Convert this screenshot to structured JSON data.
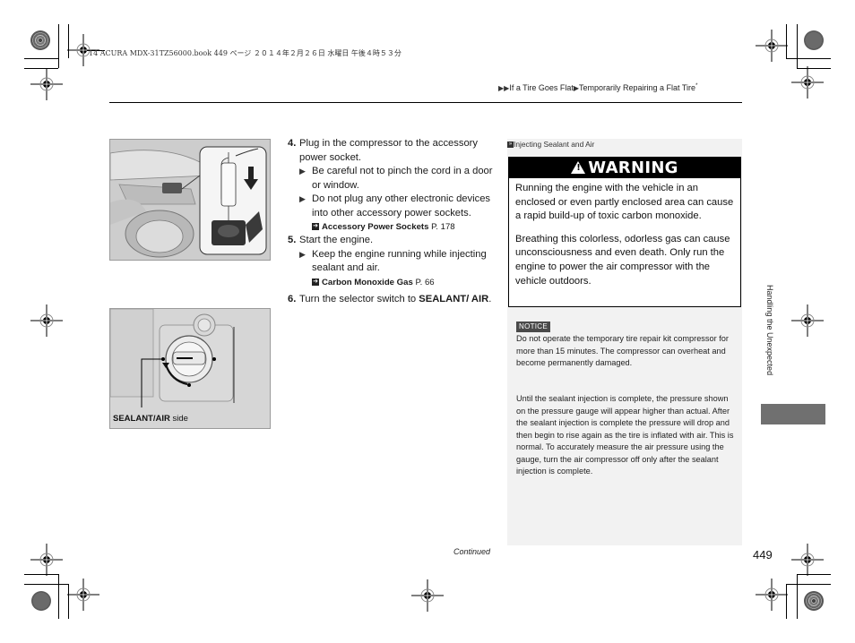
{
  "print_header": "14 ACURA MDX-31TZ56000.book  449 ページ  ２０１４年２月２６日  水曜日  午後４時５３分",
  "breadcrumb": {
    "items": [
      "If a Tire Goes Flat",
      "Temporarily Repairing a Flat Tire"
    ],
    "suffix": "*"
  },
  "figures": [
    {
      "name": "accessory-socket-illustration"
    },
    {
      "name": "selector-switch-illustration",
      "callout": {
        "bold": "SEALANT/AIR",
        "rest": " side"
      }
    }
  ],
  "steps": [
    {
      "number": "4.",
      "text": "Plug in the compressor to the accessory power socket.",
      "subs": [
        "Be careful not to pinch the cord in a door or window.",
        "Do not plug any other electronic devices into other accessory power sockets."
      ],
      "xref": {
        "title": "Accessory Power Sockets",
        "page": "P. 178"
      }
    },
    {
      "number": "5.",
      "text": "Start the engine.",
      "subs": [
        "Keep the engine running while injecting sealant and air."
      ],
      "xref": {
        "title": "Carbon Monoxide Gas",
        "page": "P. 66"
      }
    },
    {
      "number": "6.",
      "text_before": "Turn the selector switch to ",
      "text_bold": "SEALANT/ AIR",
      "text_after": "."
    }
  ],
  "sidebar": {
    "title": "Injecting Sealant and Air",
    "warning": {
      "heading": "WARNING",
      "paragraphs": [
        "Running the engine with the vehicle in an enclosed or even partly enclosed area can cause a rapid build-up of toxic carbon monoxide.",
        "Breathing this colorless, odorless gas can cause unconsciousness and even death. Only run the engine to power the air compressor with the vehicle outdoors."
      ]
    },
    "notice": {
      "badge": "NOTICE",
      "text": "Do not operate the temporary tire repair kit compressor for more than 15 minutes. The compressor can overheat and become permanently damaged."
    },
    "note": "Until the sealant injection is complete, the pressure shown on the pressure gauge will appear higher than actual. After the sealant injection is complete the pressure will drop and then begin to rise again as the tire is inflated with air. This is normal. To accurately measure the air pressure using the gauge, turn the air compressor off only after the sealant injection is complete."
  },
  "side_tab": {
    "label": "Handling the Unexpected"
  },
  "footer": {
    "continued": "Continued",
    "page_number": "449"
  }
}
